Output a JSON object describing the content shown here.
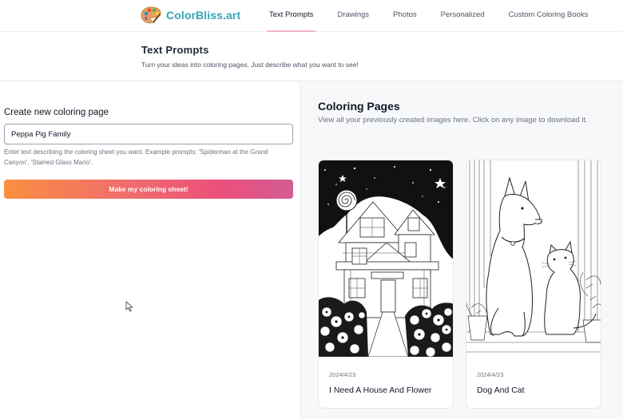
{
  "brand": {
    "name": "ColorBliss.art",
    "accent": "#35a3b7"
  },
  "nav": {
    "items": [
      {
        "label": "Text Prompts",
        "active": true
      },
      {
        "label": "Drawings",
        "active": false
      },
      {
        "label": "Photos",
        "active": false
      },
      {
        "label": "Personalized",
        "active": false
      },
      {
        "label": "Custom Coloring Books",
        "active": false
      }
    ]
  },
  "page": {
    "title": "Text Prompts",
    "subtitle": "Turn your ideas into coloring pages. Just describe what you want to see!"
  },
  "create": {
    "label": "Create new coloring page",
    "input_value": "Peppa Pig Family",
    "hint": "Enter text describing the coloring sheet you want. Example prompts: 'Spiderman at the Grand Canyon', 'Stained Glass Mario'.",
    "button_label": "Make my coloring sheet!"
  },
  "gallery": {
    "title": "Coloring Pages",
    "subtitle": "View all your previously created images here. Click on any image to download it.",
    "items": [
      {
        "date": "2024/4/23",
        "title": "I Need A House And Flower",
        "image": "house-and-flowers-coloring-page"
      },
      {
        "date": "2024/4/23",
        "title": "Dog And Cat",
        "image": "dog-and-cat-coloring-page"
      }
    ]
  }
}
